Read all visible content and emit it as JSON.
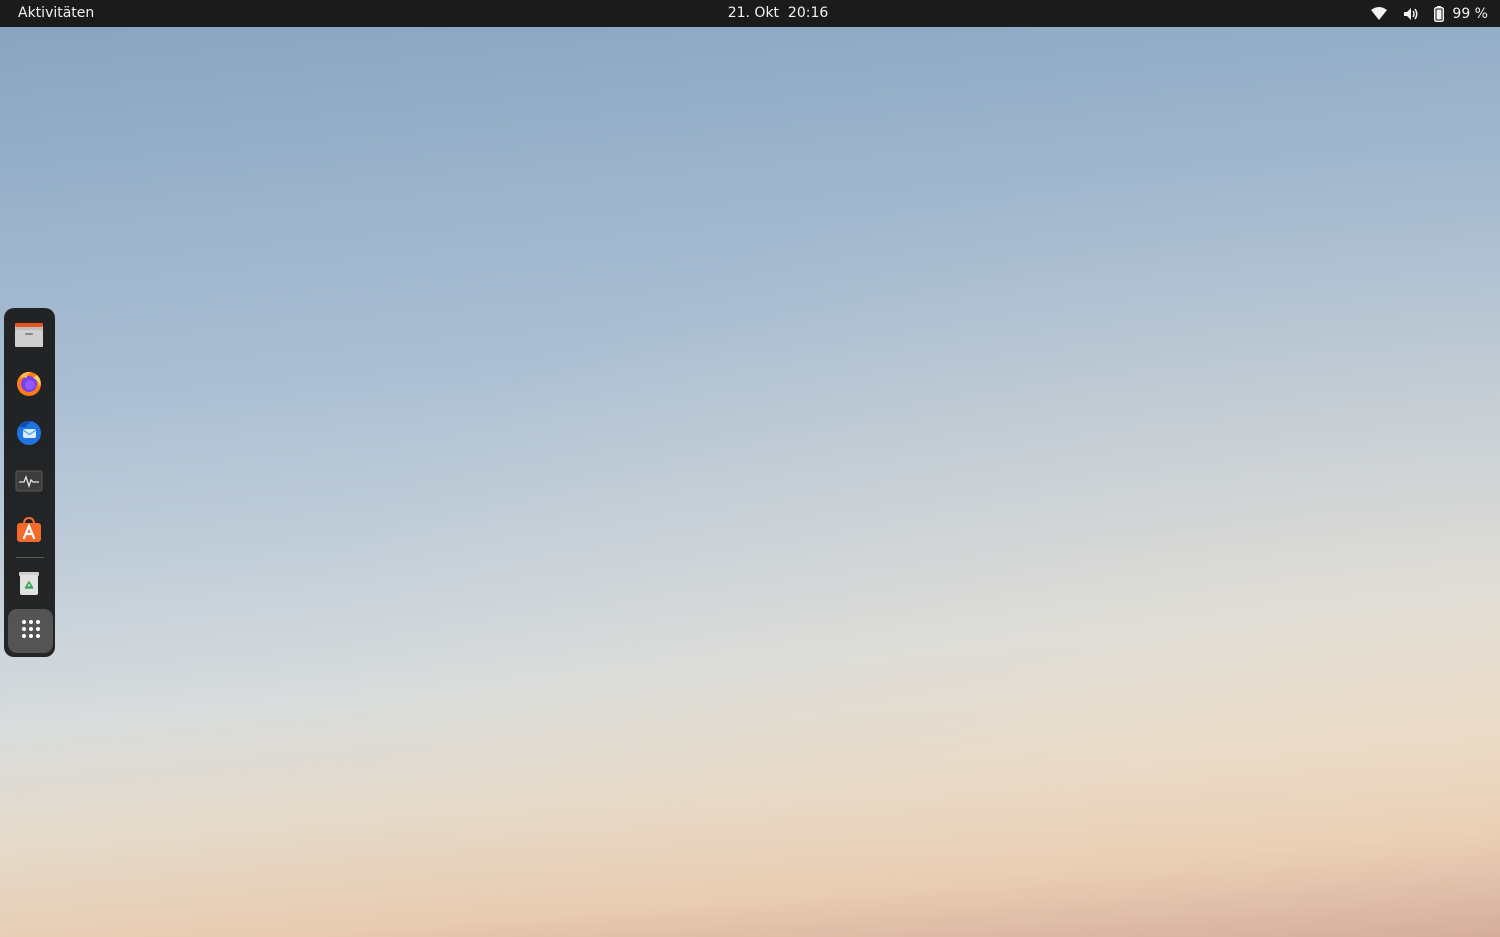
{
  "topbar": {
    "activities_label": "Aktivitäten",
    "clock": "21. Okt  20:16",
    "battery_percent": "99 %",
    "icons": [
      "wifi-icon",
      "volume-icon",
      "battery-icon"
    ]
  },
  "dock": {
    "items": [
      {
        "name": "files",
        "icon": "files-icon"
      },
      {
        "name": "firefox",
        "icon": "firefox-icon"
      },
      {
        "name": "thunderbird",
        "icon": "thunderbird-icon"
      },
      {
        "name": "system-monitor",
        "icon": "system-monitor-icon"
      },
      {
        "name": "ubuntu-software",
        "icon": "software-store-icon"
      },
      {
        "name": "trash",
        "icon": "trash-icon"
      }
    ],
    "show_apps_icon": "app-grid-icon"
  },
  "colors": {
    "topbar_bg": "#1b1b1b",
    "dock_bg": "#161616",
    "firefox_orange": "#ff7a1a",
    "thunderbird_blue": "#1f74e0",
    "software_orange": "#f26b2a"
  }
}
